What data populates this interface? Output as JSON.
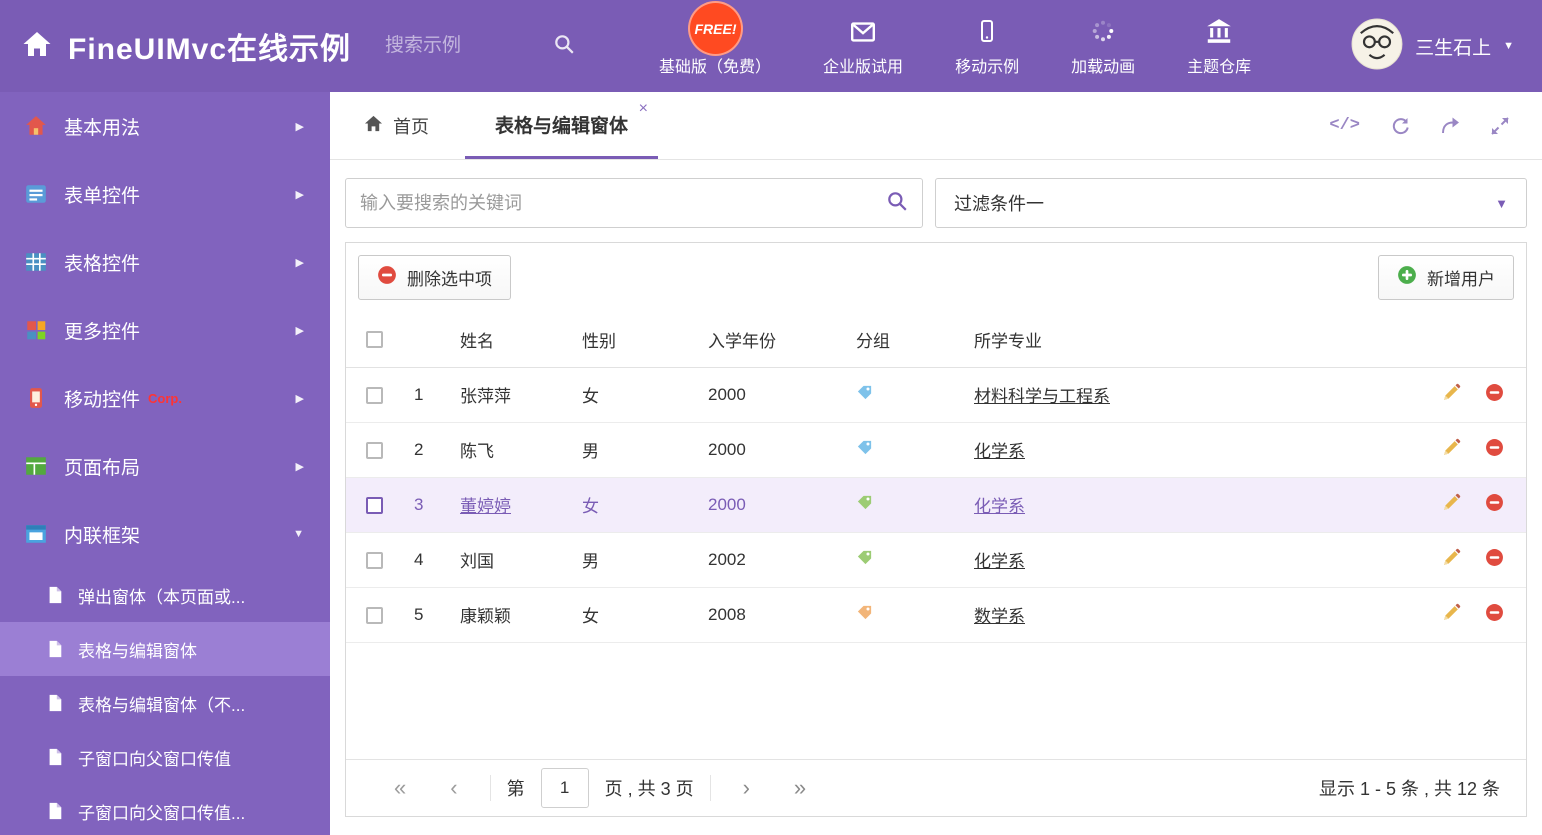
{
  "colors": {
    "header_bg": "#7a5cb5",
    "sidebar_bg": "#8163be",
    "sidebar_active_bg": "#9b7fd4",
    "accent_purple": "#7a5cb5",
    "selected_row_bg": "#f3edfb",
    "free_badge_bg": "#ff4a21",
    "delete_red": "#e04b3f",
    "add_green": "#4cae4c",
    "edit_yellow": "#e8b64c"
  },
  "header": {
    "title": "FineUIMvc在线示例",
    "search_placeholder": "搜索示例",
    "free_badge": "FREE!",
    "nav": [
      {
        "label": "基础版（免费）"
      },
      {
        "label": "企业版试用"
      },
      {
        "label": "移动示例"
      },
      {
        "label": "加载动画"
      },
      {
        "label": "主题仓库"
      }
    ],
    "user_name": "三生石上"
  },
  "sidebar": {
    "items": [
      {
        "label": "基本用法"
      },
      {
        "label": "表单控件"
      },
      {
        "label": "表格控件"
      },
      {
        "label": "更多控件"
      },
      {
        "label": "移动控件",
        "badge": "Corp."
      },
      {
        "label": "页面布局"
      },
      {
        "label": "内联框架",
        "expanded": true
      }
    ],
    "subitems": [
      {
        "label": "弹出窗体（本页面或...",
        "active": false
      },
      {
        "label": "表格与编辑窗体",
        "active": true
      },
      {
        "label": "表格与编辑窗体（不...",
        "active": false
      },
      {
        "label": "子窗口向父窗口传值",
        "active": false
      },
      {
        "label": "子窗口向父窗口传值...",
        "active": false
      }
    ]
  },
  "tabs": {
    "home": "首页",
    "active": "表格与编辑窗体",
    "close": "×"
  },
  "filter": {
    "search_placeholder": "输入要搜索的关键词",
    "selected_filter": "过滤条件一"
  },
  "grid": {
    "delete_button": "删除选中项",
    "add_button": "新增用户",
    "columns": {
      "name": "姓名",
      "gender": "性别",
      "year": "入学年份",
      "group": "分组",
      "major": "所学专业"
    },
    "rows": [
      {
        "num": "1",
        "name": "张萍萍",
        "gender": "女",
        "year": "2000",
        "tag_color": "#7ec2ea",
        "major": "材料科学与工程系",
        "selected": false
      },
      {
        "num": "2",
        "name": "陈飞",
        "gender": "男",
        "year": "2000",
        "tag_color": "#7ec2ea",
        "major": "化学系",
        "selected": false
      },
      {
        "num": "3",
        "name": "董婷婷",
        "gender": "女",
        "year": "2000",
        "tag_color": "#9ccc74",
        "major": "化学系",
        "selected": true
      },
      {
        "num": "4",
        "name": "刘国",
        "gender": "男",
        "year": "2002",
        "tag_color": "#9ccc74",
        "major": "化学系",
        "selected": false
      },
      {
        "num": "5",
        "name": "康颖颖",
        "gender": "女",
        "year": "2008",
        "tag_color": "#f2b579",
        "major": "数学系",
        "selected": false
      }
    ]
  },
  "pager": {
    "first": "«",
    "prev": "‹",
    "next": "›",
    "last": "»",
    "page_label_before": "第",
    "current_page": "1",
    "page_label_after": "页 , 共 3 页",
    "summary": "显示 1 - 5 条 , 共 12 条"
  }
}
